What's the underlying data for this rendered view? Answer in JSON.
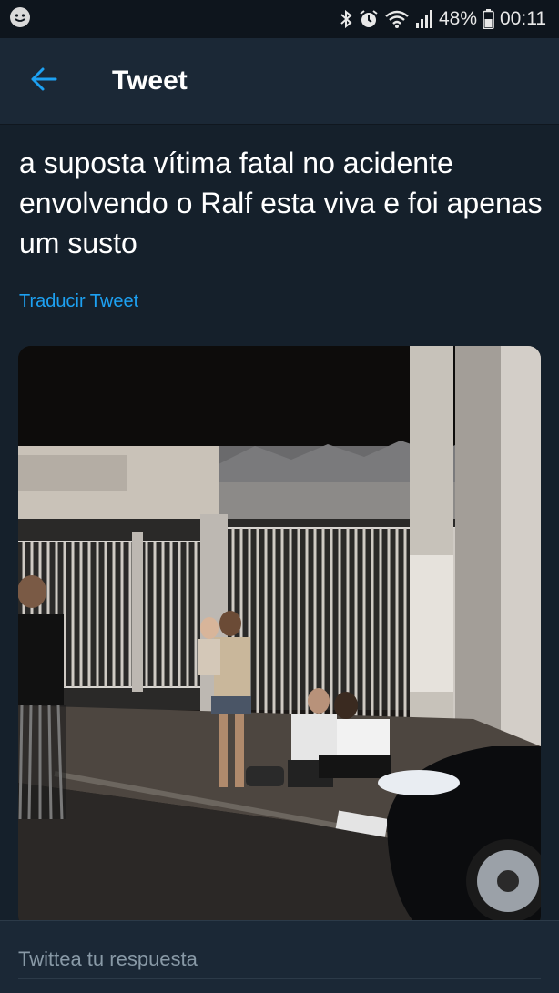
{
  "status_bar": {
    "battery_percent": "48%",
    "time": "00:11",
    "icons": [
      "app-notification-icon",
      "bluetooth-icon",
      "alarm-icon",
      "wifi-icon",
      "signal-icon",
      "battery-icon"
    ]
  },
  "header": {
    "title": "Tweet",
    "back_icon": "arrow-left-icon"
  },
  "tweet": {
    "text": "a suposta vítima fatal no acidente envolvendo o Ralf esta viva e foi apenas um susto",
    "translate_label": "Traducir Tweet"
  },
  "reply": {
    "placeholder": "Twittea tu respuesta"
  },
  "colors": {
    "background": "#15202b",
    "header": "#1b2836",
    "accent": "#1da1f2",
    "placeholder": "#8899a6"
  }
}
